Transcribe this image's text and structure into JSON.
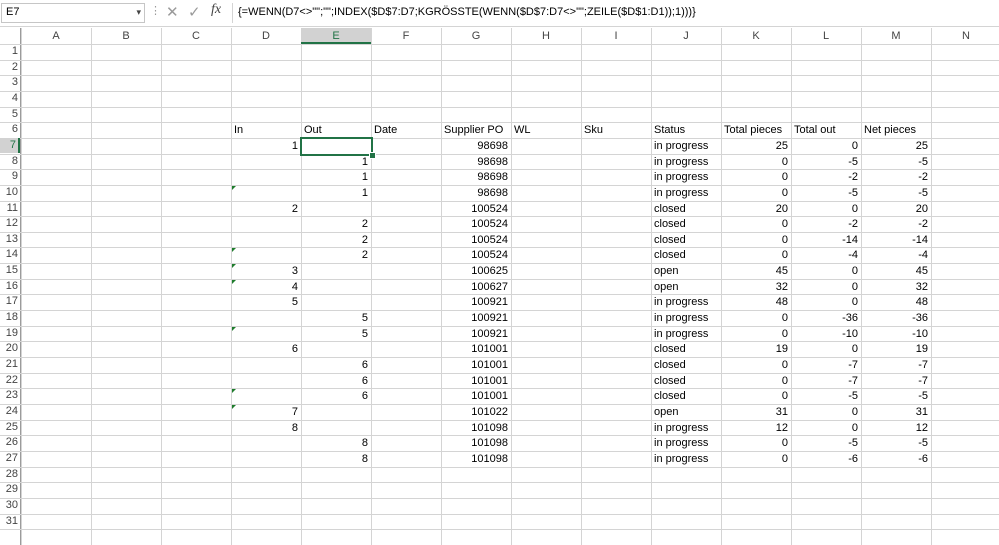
{
  "name_box": {
    "value": "E7",
    "arrow_glyph": "▾"
  },
  "formula_bar": {
    "cancel_glyph": "✕",
    "enter_glyph": "✓",
    "fx_label": "fx",
    "formula": "{=WENN(D7<>\"\";\"\";INDEX($D$7:D7;KGRÖSSTE(WENN($D$7:D7<>\"\";ZEILE($D$1:D1));1)))}"
  },
  "columns": [
    "A",
    "B",
    "C",
    "D",
    "E",
    "F",
    "G",
    "H",
    "I",
    "J",
    "K",
    "L",
    "M",
    "N"
  ],
  "rows": [
    "1",
    "2",
    "3",
    "4",
    "5",
    "6",
    "7",
    "8",
    "9",
    "10",
    "11",
    "12",
    "13",
    "14",
    "15",
    "16",
    "17",
    "18",
    "19",
    "20",
    "21",
    "22",
    "23",
    "24",
    "25",
    "26",
    "27",
    "28",
    "29",
    "30",
    "31"
  ],
  "selected": {
    "column": "E",
    "row": "7"
  },
  "table": {
    "headers": {
      "D": "In",
      "E": "Out",
      "F": "Date",
      "G": "Supplier PO",
      "H": "WL",
      "I": "Sku",
      "J": "Status",
      "K": "Total pieces",
      "L": "Total out",
      "M": "Net pieces"
    },
    "data": [
      {
        "row": "7",
        "In": "1",
        "Out": "",
        "PO": "98698",
        "Status": "in progress",
        "Total": "25",
        "TotOut": "0",
        "Net": "25"
      },
      {
        "row": "8",
        "In": "",
        "Out": "1",
        "PO": "98698",
        "Status": "in progress",
        "Total": "0",
        "TotOut": "-5",
        "Net": "-5"
      },
      {
        "row": "9",
        "In": "",
        "Out": "1",
        "PO": "98698",
        "Status": "in progress",
        "Total": "0",
        "TotOut": "-2",
        "Net": "-2"
      },
      {
        "row": "10",
        "In": "",
        "Out": "1",
        "PO": "98698",
        "Status": "in progress",
        "Total": "0",
        "TotOut": "-5",
        "Net": "-5"
      },
      {
        "row": "11",
        "In": "2",
        "Out": "",
        "PO": "100524",
        "Status": "closed",
        "Total": "20",
        "TotOut": "0",
        "Net": "20"
      },
      {
        "row": "12",
        "In": "",
        "Out": "2",
        "PO": "100524",
        "Status": "closed",
        "Total": "0",
        "TotOut": "-2",
        "Net": "-2"
      },
      {
        "row": "13",
        "In": "",
        "Out": "2",
        "PO": "100524",
        "Status": "closed",
        "Total": "0",
        "TotOut": "-14",
        "Net": "-14"
      },
      {
        "row": "14",
        "In": "",
        "Out": "2",
        "PO": "100524",
        "Status": "closed",
        "Total": "0",
        "TotOut": "-4",
        "Net": "-4"
      },
      {
        "row": "15",
        "In": "3",
        "Out": "",
        "PO": "100625",
        "Status": "open",
        "Total": "45",
        "TotOut": "0",
        "Net": "45"
      },
      {
        "row": "16",
        "In": "4",
        "Out": "",
        "PO": "100627",
        "Status": "open",
        "Total": "32",
        "TotOut": "0",
        "Net": "32"
      },
      {
        "row": "17",
        "In": "5",
        "Out": "",
        "PO": "100921",
        "Status": "in progress",
        "Total": "48",
        "TotOut": "0",
        "Net": "48"
      },
      {
        "row": "18",
        "In": "",
        "Out": "5",
        "PO": "100921",
        "Status": "in progress",
        "Total": "0",
        "TotOut": "-36",
        "Net": "-36"
      },
      {
        "row": "19",
        "In": "",
        "Out": "5",
        "PO": "100921",
        "Status": "in progress",
        "Total": "0",
        "TotOut": "-10",
        "Net": "-10"
      },
      {
        "row": "20",
        "In": "6",
        "Out": "",
        "PO": "101001",
        "Status": "closed",
        "Total": "19",
        "TotOut": "0",
        "Net": "19"
      },
      {
        "row": "21",
        "In": "",
        "Out": "6",
        "PO": "101001",
        "Status": "closed",
        "Total": "0",
        "TotOut": "-7",
        "Net": "-7"
      },
      {
        "row": "22",
        "In": "",
        "Out": "6",
        "PO": "101001",
        "Status": "closed",
        "Total": "0",
        "TotOut": "-7",
        "Net": "-7"
      },
      {
        "row": "23",
        "In": "",
        "Out": "6",
        "PO": "101001",
        "Status": "closed",
        "Total": "0",
        "TotOut": "-5",
        "Net": "-5"
      },
      {
        "row": "24",
        "In": "7",
        "Out": "",
        "PO": "101022",
        "Status": "open",
        "Total": "31",
        "TotOut": "0",
        "Net": "31"
      },
      {
        "row": "25",
        "In": "8",
        "Out": "",
        "PO": "101098",
        "Status": "in progress",
        "Total": "12",
        "TotOut": "0",
        "Net": "12"
      },
      {
        "row": "26",
        "In": "",
        "Out": "8",
        "PO": "101098",
        "Status": "in progress",
        "Total": "0",
        "TotOut": "-5",
        "Net": "-5"
      },
      {
        "row": "27",
        "In": "",
        "Out": "8",
        "PO": "101098",
        "Status": "in progress",
        "Total": "0",
        "TotOut": "-6",
        "Net": "-6"
      }
    ],
    "error_marker_cells": [
      "D10",
      "D14",
      "D15",
      "D16",
      "D19",
      "D23",
      "D24"
    ]
  },
  "colors": {
    "accent": "#217346",
    "grid": "#d4d4d4",
    "error_marker": "#1e7c2c"
  }
}
